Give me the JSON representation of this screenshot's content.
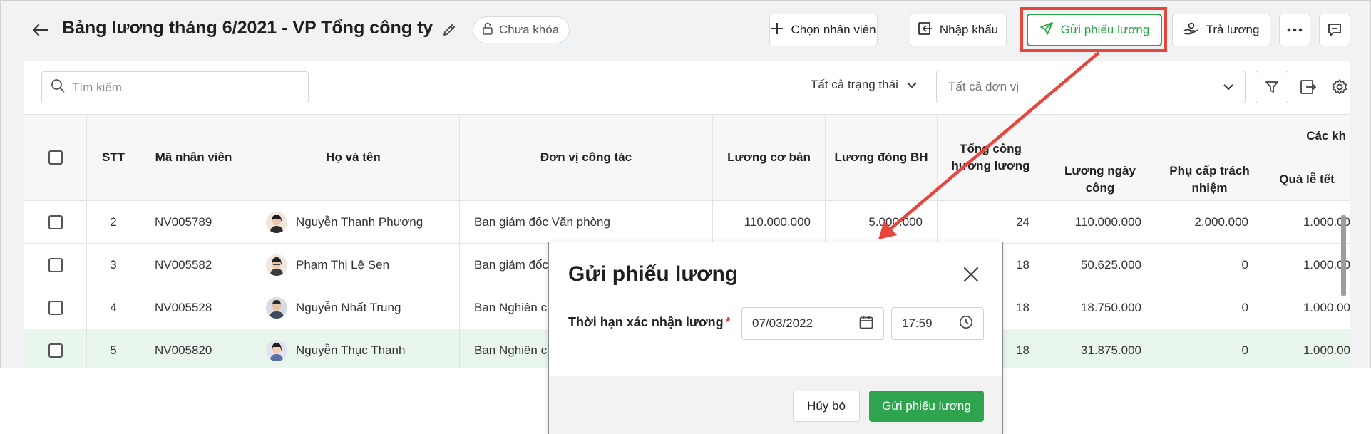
{
  "header": {
    "title": "Bảng lương tháng 6/2021 - VP Tổng công ty",
    "lock_status": "Chưa khóa",
    "buttons": {
      "choose_employee": "Chọn nhân viên",
      "import": "Nhập khẩu",
      "send_payslip": "Gửi phiếu lương",
      "pay_salary": "Trả lương"
    }
  },
  "toolbar": {
    "search_placeholder": "Tìm kiếm",
    "status_filter": "Tất cả trạng thái",
    "unit_filter": "Tất cả đơn vị"
  },
  "table": {
    "headers": {
      "stt": "STT",
      "code": "Mã nhân viên",
      "name": "Họ và tên",
      "unit": "Đơn vị công tác",
      "base_salary": "Lương cơ bản",
      "insurance_salary": "Lương đóng BH",
      "total_workdays": "Tổng công hưởng lương",
      "group": "Các kh",
      "daily_salary": "Lương ngày công",
      "allowance": "Phụ cấp trách nhiệm",
      "holiday_gift": "Quà lễ tết"
    },
    "rows": [
      {
        "stt": "2",
        "code": "NV005789",
        "name": "Nguyễn Thanh Phương",
        "unit": "Ban giám đốc Văn phòng",
        "base_salary": "110.000.000",
        "insurance_salary": "5.000.000",
        "total_workdays": "24",
        "daily_salary": "110.000.000",
        "allowance": "2.000.000",
        "holiday_gift": "1.000.00"
      },
      {
        "stt": "3",
        "code": "NV005582",
        "name": "Phạm Thị Lệ Sen",
        "unit": "Ban giám đốc",
        "base_salary": "",
        "insurance_salary": "",
        "total_workdays": "18",
        "daily_salary": "50.625.000",
        "allowance": "0",
        "holiday_gift": "1.000.00"
      },
      {
        "stt": "4",
        "code": "NV005528",
        "name": "Nguyễn Nhất Trung",
        "unit": "Ban Nghiên c",
        "base_salary": "",
        "insurance_salary": "",
        "total_workdays": "18",
        "daily_salary": "18.750.000",
        "allowance": "0",
        "holiday_gift": "1.000.00"
      },
      {
        "stt": "5",
        "code": "NV005820",
        "name": "Nguyễn Thục Thanh",
        "unit": "Ban Nghiên c",
        "base_salary": "",
        "insurance_salary": "",
        "total_workdays": "18",
        "daily_salary": "31.875.000",
        "allowance": "0",
        "holiday_gift": "1.000.00"
      }
    ]
  },
  "dialog": {
    "title": "Gửi phiếu lương",
    "deadline_label": "Thời hạn xác nhận lương",
    "required_mark": "*",
    "date": "07/03/2022",
    "time": "17:59",
    "cancel": "Hủy bỏ",
    "confirm": "Gửi phiếu lương"
  },
  "colors": {
    "accent_green": "#27a844",
    "highlight_red": "#e8453c",
    "selected_row": "#e9f6ee"
  }
}
